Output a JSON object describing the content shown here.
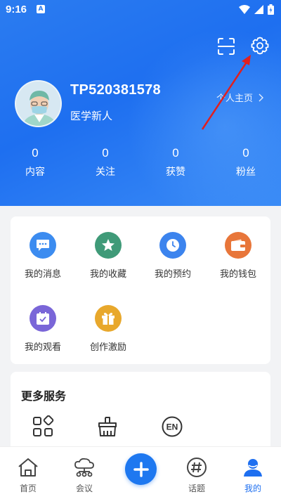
{
  "status_bar": {
    "time": "9:16",
    "notification": "A"
  },
  "profile": {
    "username": "TP520381578",
    "title": "医学新人",
    "homepage_link": "个人主页",
    "stats": [
      {
        "value": "0",
        "label": "内容"
      },
      {
        "value": "0",
        "label": "关注"
      },
      {
        "value": "0",
        "label": "获赞"
      },
      {
        "value": "0",
        "label": "粉丝"
      }
    ]
  },
  "features": [
    {
      "label": "我的消息",
      "icon": "message-icon",
      "color": "#3c8cf0"
    },
    {
      "label": "我的收藏",
      "icon": "star-icon",
      "color": "#3f9a78"
    },
    {
      "label": "我的预约",
      "icon": "clock-icon",
      "color": "#3c84ee"
    },
    {
      "label": "我的钱包",
      "icon": "wallet-icon",
      "color": "#e8763a"
    },
    {
      "label": "我的观看",
      "icon": "calendar-check-icon",
      "color": "#7a66d8"
    },
    {
      "label": "创作激励",
      "icon": "gift-icon",
      "color": "#e8a82c"
    }
  ],
  "more_services": {
    "title": "更多服务",
    "items": [
      {
        "icon": "apps-grid-icon"
      },
      {
        "icon": "broom-icon"
      },
      {
        "icon": "english-icon",
        "text": "EN"
      }
    ]
  },
  "bottom_nav": [
    {
      "label": "首页",
      "icon": "home-icon"
    },
    {
      "label": "会议",
      "icon": "cloud-network-icon"
    },
    {
      "label": "",
      "icon": "plus-icon"
    },
    {
      "label": "话题",
      "icon": "hashtag-icon"
    },
    {
      "label": "我的",
      "icon": "person-icon",
      "active": true
    }
  ],
  "colors": {
    "primary": "#1e6ff0",
    "annotation_arrow": "#e02020"
  }
}
